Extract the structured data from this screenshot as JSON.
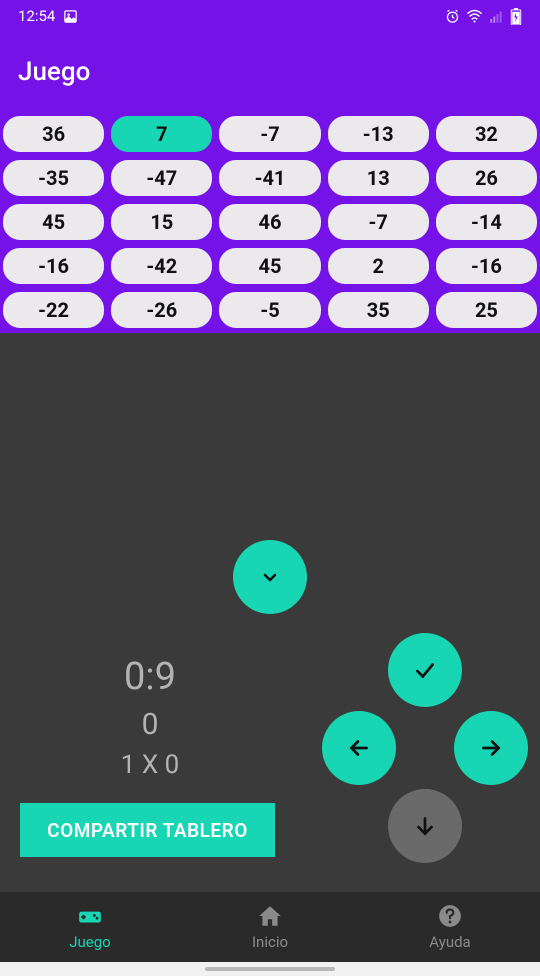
{
  "status": {
    "time": "12:54"
  },
  "appbar": {
    "title": "Juego"
  },
  "grid": {
    "rows": [
      [
        "36",
        "7",
        "-7",
        "-13",
        "32"
      ],
      [
        "-35",
        "-47",
        "-41",
        "13",
        "26"
      ],
      [
        "45",
        "15",
        "46",
        "-7",
        "-14"
      ],
      [
        "-16",
        "-42",
        "45",
        "2",
        "-16"
      ],
      [
        "-22",
        "-26",
        "-5",
        "35",
        "25"
      ]
    ],
    "selected": {
      "row": 0,
      "col": 1
    }
  },
  "game": {
    "timer": "0:9",
    "score": "0",
    "multiplier": "1 X 0"
  },
  "share": {
    "label": "COMPARTIR TABLERO"
  },
  "nav": {
    "items": [
      {
        "label": "Juego",
        "icon": "gamepad-icon",
        "active": true
      },
      {
        "label": "Inicio",
        "icon": "home-icon",
        "active": false
      },
      {
        "label": "Ayuda",
        "icon": "help-icon",
        "active": false
      }
    ]
  }
}
